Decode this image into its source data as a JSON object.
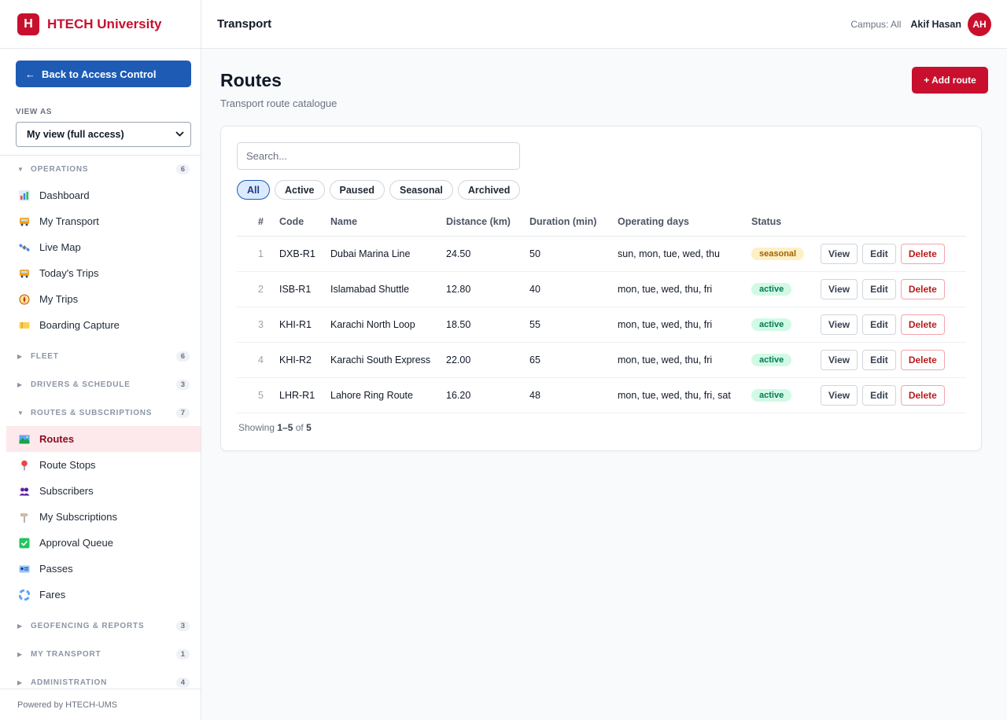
{
  "brand": {
    "logo_letter": "H",
    "name": "HTECH University"
  },
  "sidebar": {
    "back_label": "Back to Access Control",
    "view_as_label": "VIEW AS",
    "view_as_value": "My view (full access)",
    "groups": [
      {
        "name": "OPERATIONS",
        "count": "6",
        "expanded": true,
        "items": [
          {
            "label": "Dashboard",
            "icon": "bar-chart-icon"
          },
          {
            "label": "My Transport",
            "icon": "bus-icon"
          },
          {
            "label": "Live Map",
            "icon": "satellite-icon"
          },
          {
            "label": "Today's Trips",
            "icon": "bus-icon"
          },
          {
            "label": "My Trips",
            "icon": "compass-icon"
          },
          {
            "label": "Boarding Capture",
            "icon": "ticket-icon"
          }
        ]
      },
      {
        "name": "FLEET",
        "count": "6",
        "expanded": false
      },
      {
        "name": "DRIVERS & SCHEDULE",
        "count": "3",
        "expanded": false
      },
      {
        "name": "ROUTES & SUBSCRIPTIONS",
        "count": "7",
        "expanded": true,
        "items": [
          {
            "label": "Routes",
            "icon": "map-icon",
            "active": true
          },
          {
            "label": "Route Stops",
            "icon": "pin-icon"
          },
          {
            "label": "Subscribers",
            "icon": "users-icon"
          },
          {
            "label": "My Subscriptions",
            "icon": "signpost-icon"
          },
          {
            "label": "Approval Queue",
            "icon": "check-box-icon"
          },
          {
            "label": "Passes",
            "icon": "id-card-icon"
          },
          {
            "label": "Fares",
            "icon": "lifebuoy-icon"
          }
        ]
      },
      {
        "name": "GEOFENCING & REPORTS",
        "count": "3",
        "expanded": false
      },
      {
        "name": "MY TRANSPORT",
        "count": "1",
        "expanded": false
      },
      {
        "name": "ADMINISTRATION",
        "count": "4",
        "expanded": false
      }
    ],
    "footer": "Powered by HTECH-UMS"
  },
  "topbar": {
    "title": "Transport",
    "campus": "Campus: All",
    "user": "Akif Hasan",
    "avatar_initials": "AH"
  },
  "page": {
    "title": "Routes",
    "subtitle": "Transport route catalogue",
    "add_button": "+ Add route",
    "search_placeholder": "Search...",
    "filters": [
      "All",
      "Active",
      "Paused",
      "Seasonal",
      "Archived"
    ],
    "active_filter": "All",
    "columns": [
      "#",
      "Code",
      "Name",
      "Distance (km)",
      "Duration (min)",
      "Operating days",
      "Status"
    ],
    "rows": [
      {
        "num": "1",
        "code": "DXB-R1",
        "name": "Dubai Marina Line",
        "distance": "24.50",
        "duration": "50",
        "days": "sun, mon, tue, wed, thu",
        "status": "seasonal"
      },
      {
        "num": "2",
        "code": "ISB-R1",
        "name": "Islamabad Shuttle",
        "distance": "12.80",
        "duration": "40",
        "days": "mon, tue, wed, thu, fri",
        "status": "active"
      },
      {
        "num": "3",
        "code": "KHI-R1",
        "name": "Karachi North Loop",
        "distance": "18.50",
        "duration": "55",
        "days": "mon, tue, wed, thu, fri",
        "status": "active"
      },
      {
        "num": "4",
        "code": "KHI-R2",
        "name": "Karachi South Express",
        "distance": "22.00",
        "duration": "65",
        "days": "mon, tue, wed, thu, fri",
        "status": "active"
      },
      {
        "num": "5",
        "code": "LHR-R1",
        "name": "Lahore Ring Route",
        "distance": "16.20",
        "duration": "48",
        "days": "mon, tue, wed, thu, fri, sat",
        "status": "active"
      }
    ],
    "row_actions": {
      "view": "View",
      "edit": "Edit",
      "delete": "Delete"
    },
    "showing": {
      "prefix": "Showing ",
      "range": "1–5",
      "of": " of ",
      "total": "5"
    }
  },
  "colors": {
    "brand_red": "#c8102e",
    "accent_blue": "#1d5bb5",
    "active_nav_bg": "#fde9ec"
  }
}
